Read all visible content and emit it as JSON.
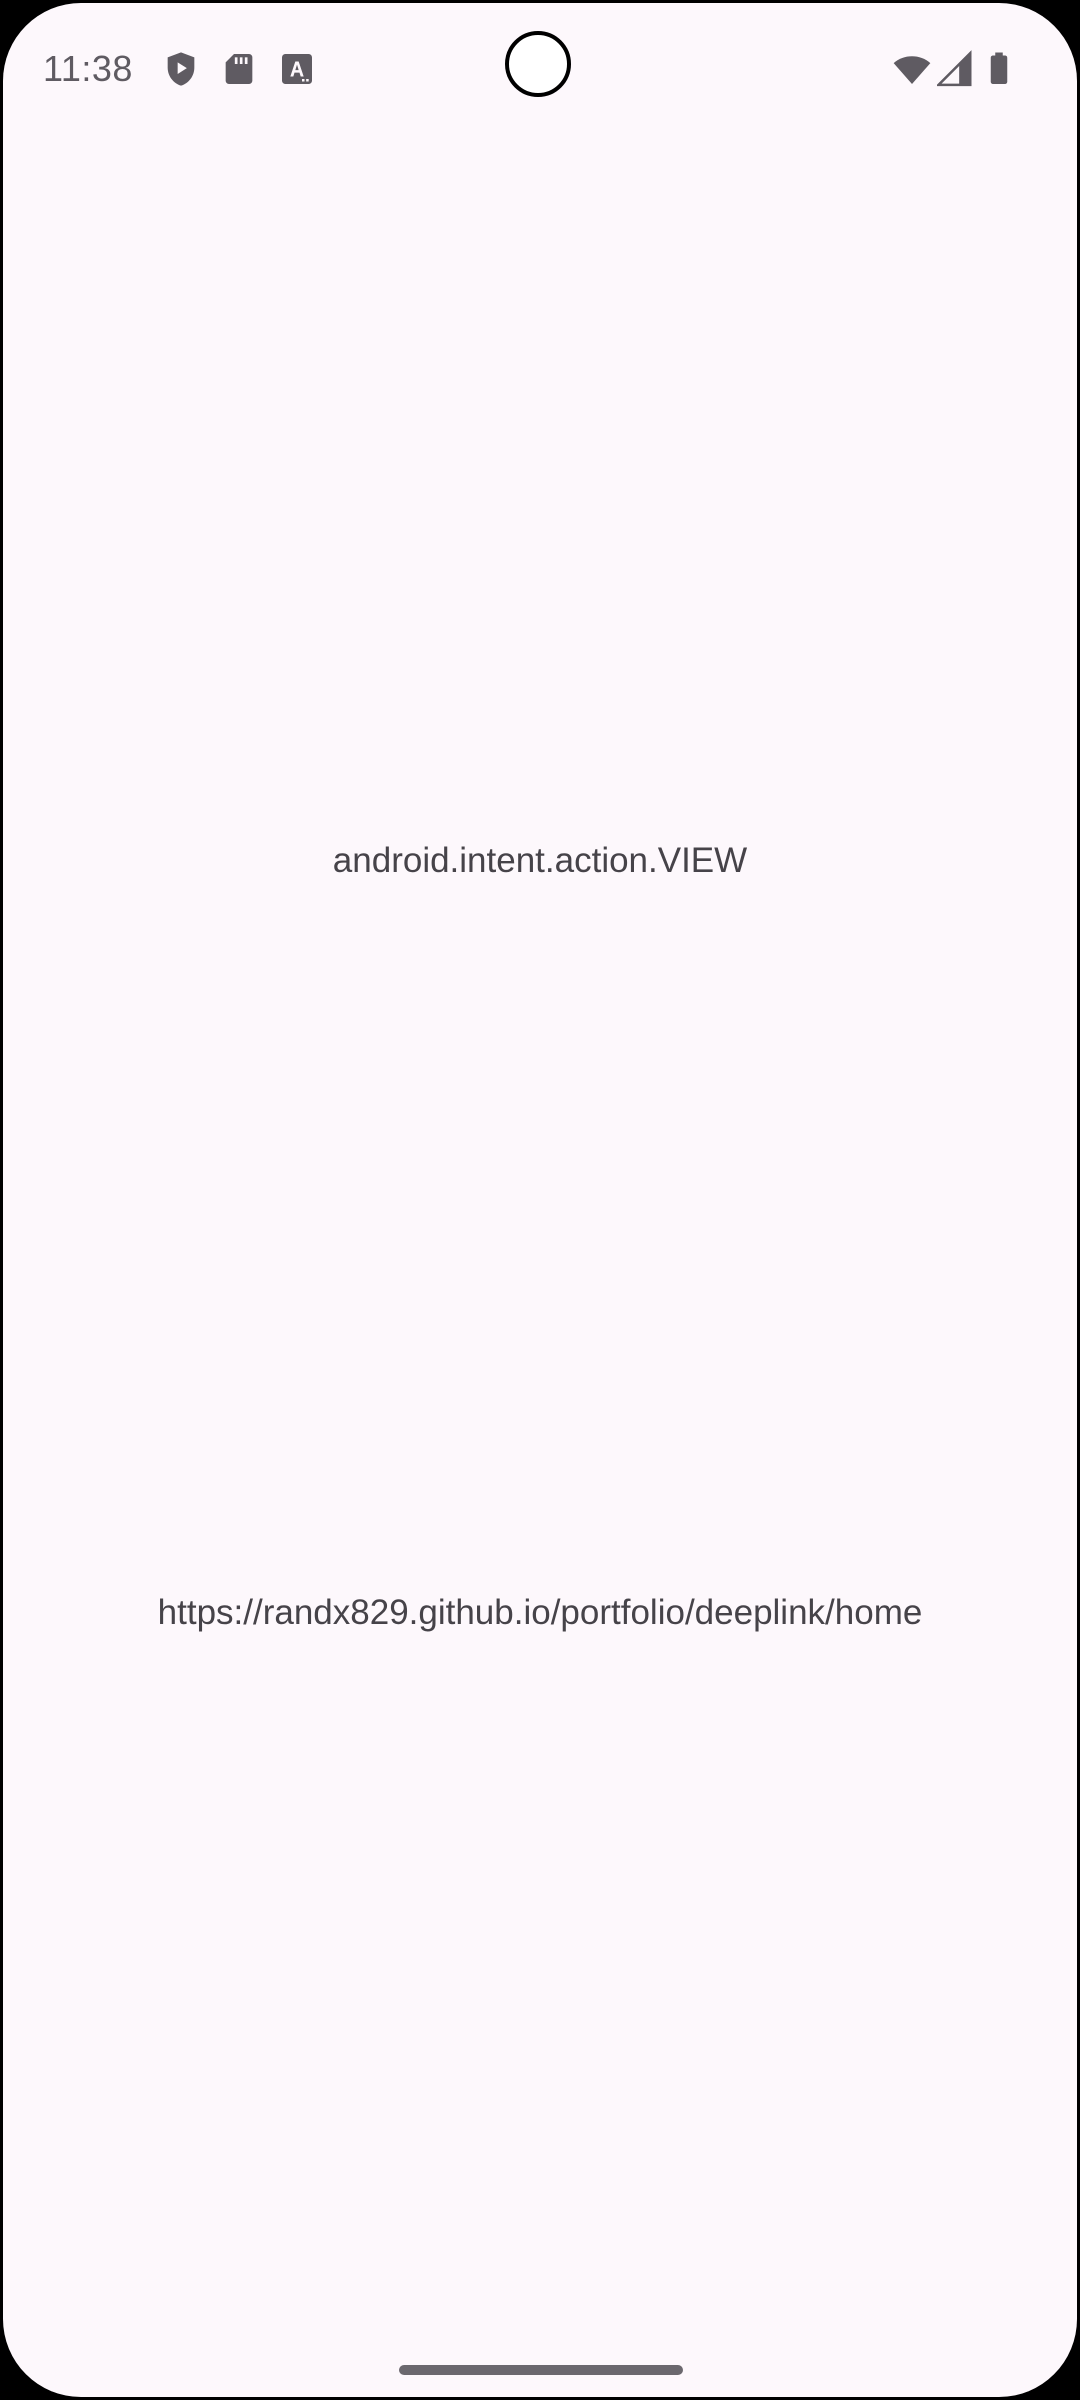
{
  "status_bar": {
    "time": "11:38",
    "left_icons": [
      "play-protect-icon",
      "sd-card-icon",
      "text-a-icon"
    ],
    "right_icons": [
      "wifi-icon",
      "cell-signal-icon",
      "battery-icon"
    ]
  },
  "main": {
    "intent_action": "android.intent.action.VIEW",
    "intent_data": "https://randx829.github.io/portfolio/deeplink/home"
  },
  "colors": {
    "background": "#fdf8fc",
    "text": "#464349",
    "icons": "#5f5b62"
  }
}
